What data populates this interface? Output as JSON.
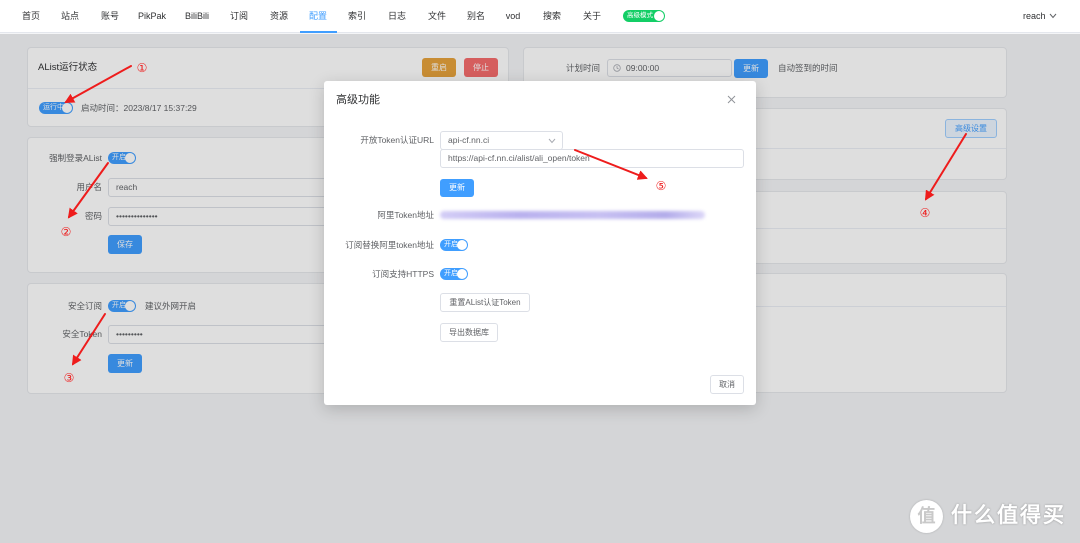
{
  "nav": {
    "items": [
      "首页",
      "站点",
      "账号",
      "PikPak",
      "BiliBili",
      "订阅",
      "资源",
      "配置",
      "索引",
      "日志",
      "文件",
      "别名",
      "vod",
      "搜索",
      "关于"
    ],
    "active": "配置",
    "advanced_mode_label": "高级模式",
    "user": "reach"
  },
  "alist_status": {
    "title": "AList运行状态",
    "restart": "重启",
    "stop": "停止",
    "running": "运行中",
    "start_time": "启动时间：2023/8/17 15:37:29"
  },
  "login": {
    "force_login_label": "强制登录AList",
    "force_login_switch": "开启",
    "username_label": "用户名",
    "username_value": "reach",
    "password_label": "密码",
    "password_value": "••••••••••••••",
    "save": "保存"
  },
  "security": {
    "secure_sub_label": "安全订阅",
    "secure_sub_switch": "开启",
    "hint": "建议外网开启",
    "token_label": "安全Token",
    "token_value": "•••••••••",
    "update": "更新"
  },
  "schedule": {
    "label": "计划时间",
    "time": "09:00:00",
    "update": "更新",
    "hint": "自动签到的时间"
  },
  "advanced_settings_button": "高级设置",
  "dialog": {
    "title": "高级功能",
    "token_url_label": "开放Token认证URL",
    "token_url_select": "api-cf.nn.ci",
    "token_url_value": "https://api-cf.nn.ci/alist/ali_open/token",
    "update": "更新",
    "ali_token_label": "阿里Token地址",
    "sub_replace_label": "订阅替换阿里token地址",
    "sub_replace_switch": "开启",
    "sub_https_label": "订阅支持HTTPS",
    "sub_https_switch": "开启",
    "reset_token": "重置AList认证Token",
    "export_db": "导出数据库",
    "cancel": "取消"
  },
  "annotations": [
    "①",
    "②",
    "③",
    "④",
    "⑤"
  ],
  "watermark": {
    "logo": "值",
    "text": "什么值得买"
  },
  "icons": {
    "user_menu_arrow": "chevron-down-icon",
    "select_arrow": "chevron-down-icon",
    "time_input": "clock-icon",
    "dialog_close": "close-icon",
    "watermark_logo": "smzdm-logo-icon"
  },
  "colors": {
    "primary": "#409eff",
    "warning": "#e6a23c",
    "danger": "#f56c6c",
    "advanced_mode": "#13ce66",
    "annotation": "#ee1c1c"
  }
}
